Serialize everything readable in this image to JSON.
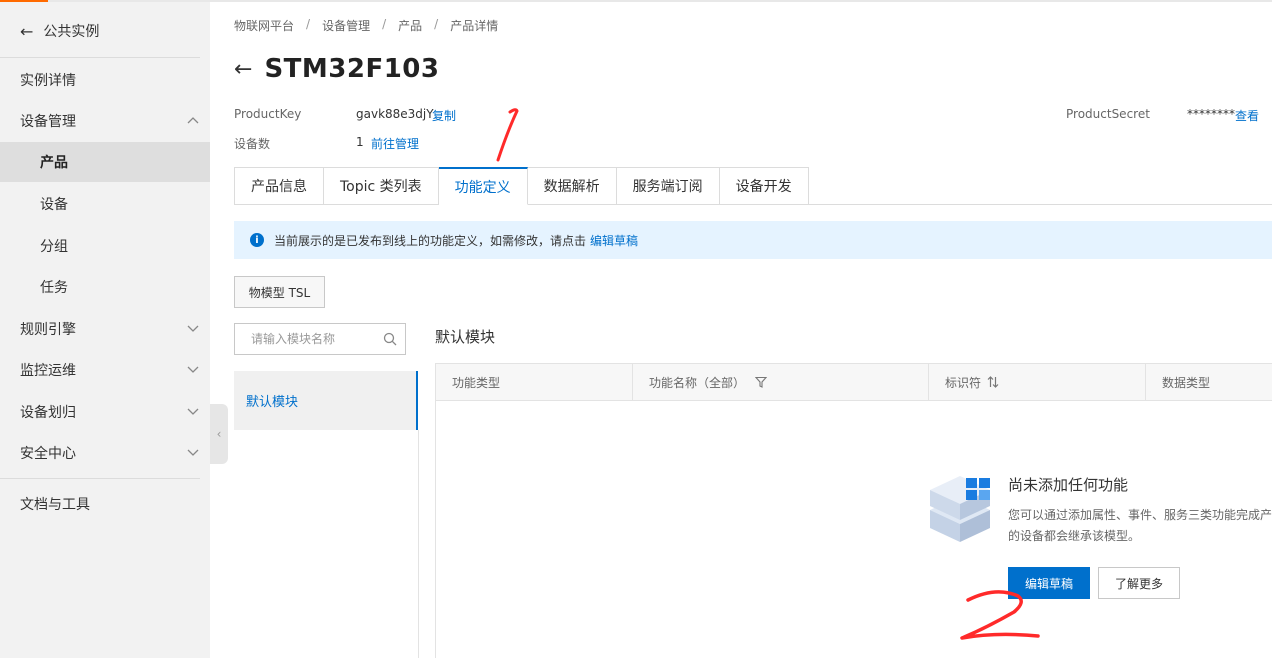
{
  "sidebar": {
    "back_label": "公共实例",
    "items": [
      {
        "label": "实例详情"
      },
      {
        "label": "设备管理"
      },
      {
        "label": "产品"
      },
      {
        "label": "设备"
      },
      {
        "label": "分组"
      },
      {
        "label": "任务"
      },
      {
        "label": "规则引擎"
      },
      {
        "label": "监控运维"
      },
      {
        "label": "设备划归"
      },
      {
        "label": "安全中心"
      },
      {
        "label": "文档与工具"
      }
    ],
    "active_item": "产品"
  },
  "breadcrumb": [
    "物联网平台",
    "设备管理",
    "产品",
    "产品详情"
  ],
  "breadcrumb_sep": "/",
  "page": {
    "title": "STM32F103",
    "product_key_label": "ProductKey",
    "product_key_value": "gavk88e3djY",
    "copy_link": "复制",
    "device_count_label": "设备数",
    "device_count_value": "1",
    "manage_link": "前往管理",
    "product_secret_label": "ProductSecret",
    "product_secret_value": "********",
    "view_link": "查看"
  },
  "tabs": [
    {
      "label": "产品信息"
    },
    {
      "label": "Topic 类列表"
    },
    {
      "label": "功能定义"
    },
    {
      "label": "数据解析"
    },
    {
      "label": "服务端订阅"
    },
    {
      "label": "设备开发"
    }
  ],
  "active_tab": "功能定义",
  "notice": {
    "text": "当前展示的是已发布到线上的功能定义，如需修改，请点击",
    "link": "编辑草稿"
  },
  "tsl_button": "物模型 TSL",
  "module_search": {
    "placeholder": "请输入模块名称"
  },
  "modules": [
    {
      "label": "默认模块"
    }
  ],
  "section_title": "默认模块",
  "table": {
    "columns": [
      "功能类型",
      "功能名称（全部）",
      "标识符",
      "数据类型"
    ]
  },
  "empty_state": {
    "title": "尚未添加任何功能",
    "desc_line1": "您可以通过添加属性、事件、服务三类功能完成产",
    "desc_line2": "的设备都会继承该模型。",
    "primary_button": "编辑草稿",
    "secondary_button": "了解更多"
  },
  "annotations": [
    "1",
    "2"
  ],
  "colors": {
    "accent": "#0070cc",
    "brand": "#ff6a00",
    "annotation": "#ff2a2a"
  }
}
